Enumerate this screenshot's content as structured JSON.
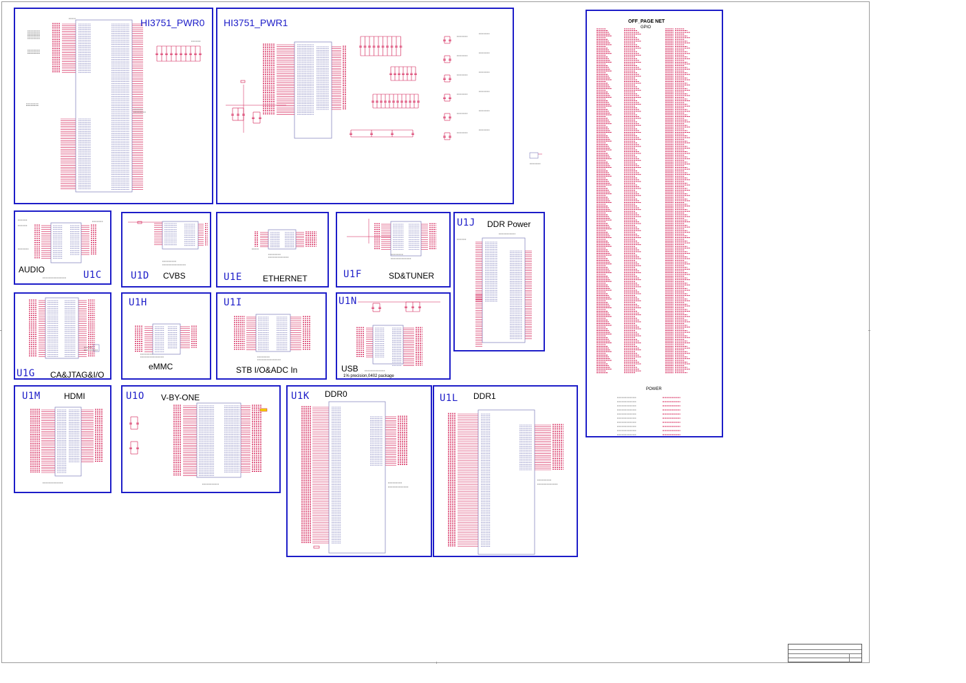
{
  "blocks": {
    "pwr0": {
      "title": "HI3751_PWR0"
    },
    "pwr1": {
      "title": "HI3751_PWR1"
    },
    "audio": {
      "label": "AUDIO",
      "id": "U1C"
    },
    "cvbs": {
      "label": "CVBS",
      "id": "U1D"
    },
    "ethernet": {
      "label": "ETHERNET",
      "id": "U1E"
    },
    "sdtuner": {
      "label": "SD&TUNER",
      "id": "U1F"
    },
    "ddrpower": {
      "label": "DDR Power",
      "id": "U1J"
    },
    "cajtag": {
      "label": "CA&JTAG&I/O",
      "id": "U1G"
    },
    "emmc": {
      "label": "eMMC",
      "id": "U1H"
    },
    "stbio": {
      "label": "STB I/O&ADC In",
      "id": "U1I"
    },
    "usb": {
      "label": "USB",
      "id": "U1N",
      "note": "1%  precision,0402 package"
    },
    "hdmi": {
      "label": "HDMI",
      "id": "U1M"
    },
    "vbyone": {
      "label": "V-BY-ONE",
      "id": "U1O"
    },
    "ddr0": {
      "label": "DDR0",
      "id": "U1K"
    },
    "ddr1": {
      "label": "DDR1",
      "id": "U1L"
    },
    "offpage": {
      "title": "OFF_PAGE NET",
      "gpio": "GPIO",
      "power": "POWER"
    }
  },
  "colors": {
    "frame": "#1c1cc8",
    "wire": "#d0104a",
    "part": "#7a7ab8",
    "text": "#000000"
  }
}
